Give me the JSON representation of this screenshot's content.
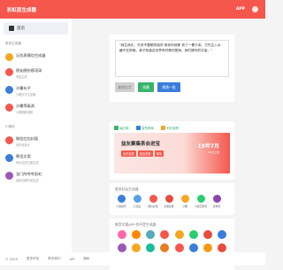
{
  "header": {
    "title": "彩虹屁生成器",
    "app_label": "APP"
  },
  "sidebar": {
    "home_label": "首页",
    "section_tools": "更多生成器",
    "tools": [
      {
        "label": "记仇表情包生成器",
        "sub": ""
      },
      {
        "label": "朋友圈伤感语录",
        "sub": "恒星生成"
      },
      {
        "label": "沙雕句子",
        "sub": "沙雕文字生成器"
      },
      {
        "label": "沙雕等级测",
        "sub": "沙雕指数测算"
      }
    ],
    "section_mini": "小程序",
    "minis": [
      {
        "label": "微信红包封面",
        "sub": "多样化设计"
      },
      {
        "label": "朝圣文案",
        "sub": "有诗意的文案生成"
      },
      {
        "label": "龙门阵夸夸彩虹",
        "sub": "适用无聊时间生成"
      }
    ]
  },
  "main": {
    "quote": "\"我生病头，先来不要眼的桃风 故你你就那 到了一晕卡亲。方先生入水 藏不在夜晚，我才知道这世界有好像的是我。我们挪你的宇宙。\"",
    "copy_btn": "复制文字",
    "fav_btn": "收藏",
    "next_btn": "换换一批",
    "chips": [
      "每日新",
      "智慧榜单",
      "彩虹屁榜"
    ],
    "banner_title": "益友聚集茶会进宝",
    "banner_tags": [
      "合作嘉宾",
      "连连茶馆",
      "现场"
    ],
    "banner_date": "19年7月",
    "banner_sub": "20点上线",
    "gen_title": "更多好玩生成器",
    "gen_tools": [
      "小鬼提问",
      "沙比生",
      "微信彩蛋",
      "头像生成",
      "沙雕",
      "小霸王游戏",
      "表情包"
    ],
    "more_title": "推荐文案APP·你不是生成器"
  },
  "footer": {
    "items": [
      "© 2025",
      "更多好站",
      "联系我们",
      "API",
      "隐私"
    ]
  },
  "colors": {
    "brand": "#f5574d",
    "fav": "#38b46b",
    "next": "#3a7ddc",
    "tool_colors": [
      "#f5a623",
      "#f5574d",
      "#3a7ddc",
      "#f5574d",
      "#9b59b6",
      "#3a7ddc",
      "#38b46b"
    ],
    "gen_colors": [
      "#3a7ddc",
      "#5aa0e6",
      "#f5574d",
      "#e74c3c",
      "#f5a623",
      "#2ecc71",
      "#8e44ad"
    ],
    "more_colors": [
      "#f6a",
      "#f80",
      "#5ab",
      "#f5574d",
      "#f5a623",
      "#2ecc71",
      "#e74c3c",
      "#3a7ddc",
      "#9b59b6",
      "#f5a623",
      "#1abc9c",
      "#e67e22",
      "#f5574d",
      "#3a7ddc",
      "#f39c12",
      "#e74c3c"
    ]
  }
}
